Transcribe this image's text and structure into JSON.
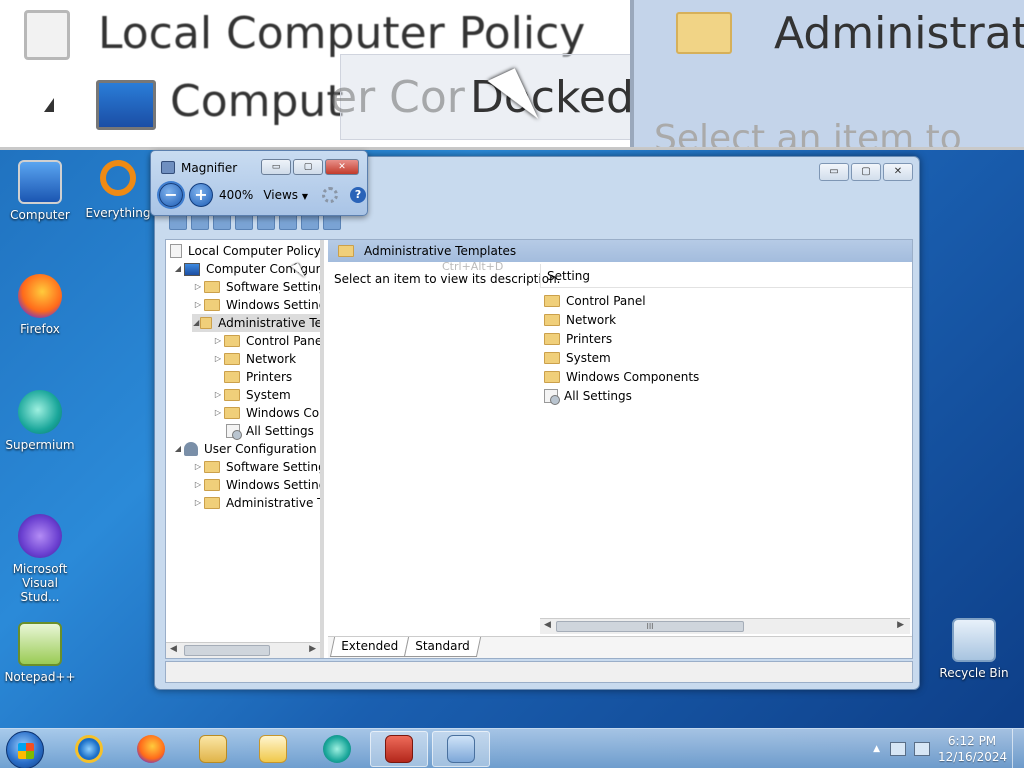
{
  "magnifier_view": {
    "title": "Local Computer Policy",
    "computer_partial": "Comput",
    "ghost_text": "er Cor",
    "docked_text": "Docked",
    "right_title": "Administrat",
    "select_text": "Select an item to"
  },
  "desktop": {
    "icons": [
      {
        "label": "Computer",
        "icon": "computer-icon"
      },
      {
        "label": "Everything",
        "icon": "everything-icon"
      },
      {
        "label": "Firefox",
        "icon": "firefox-icon"
      },
      {
        "label": "Supermium",
        "icon": "supermium-icon"
      },
      {
        "label": "Microsoft Visual Stud...",
        "icon": "visual-studio-icon"
      },
      {
        "label": "Notepad++",
        "icon": "notepad-plus-plus-icon"
      },
      {
        "label": "Recycle Bin",
        "icon": "recycle-bin-icon"
      }
    ]
  },
  "magnifier": {
    "title": "Magnifier",
    "zoom": "400%",
    "views": "Views",
    "minus": "−",
    "plus": "+",
    "help": "?",
    "min_btn": "▭",
    "max_btn": "▢",
    "close_btn": "✕"
  },
  "gp_window": {
    "win_min": "▭",
    "win_max": "▢",
    "win_close": "✕",
    "tree": {
      "root": "Local Computer Policy",
      "computer_config": "Computer Configura",
      "cc_software": "Software Settings",
      "cc_windows": "Windows Setting",
      "cc_admin": "Administrative Te",
      "at_control_panel": "Control Panel",
      "at_network": "Network",
      "at_printers": "Printers",
      "at_system": "System",
      "at_windows_comp": "Windows Cor",
      "at_all_settings": "All Settings",
      "user_config": "User Configuration",
      "uc_software": "Software Settings",
      "uc_windows": "Windows Setting",
      "uc_admin": "Administrative Te"
    },
    "right": {
      "header": "Administrative Templates",
      "ghost": "Ctrl+Alt+D",
      "description": "Select an item to view its description.",
      "column": "Setting",
      "items": [
        "Control Panel",
        "Network",
        "Printers",
        "System",
        "Windows Components",
        "All Settings"
      ],
      "scroll_grip": "III",
      "tabs": [
        "Extended",
        "Standard"
      ]
    }
  },
  "taskbar": {
    "time": "6:12 PM",
    "date": "12/16/2024",
    "tray_arrow": "▲"
  }
}
